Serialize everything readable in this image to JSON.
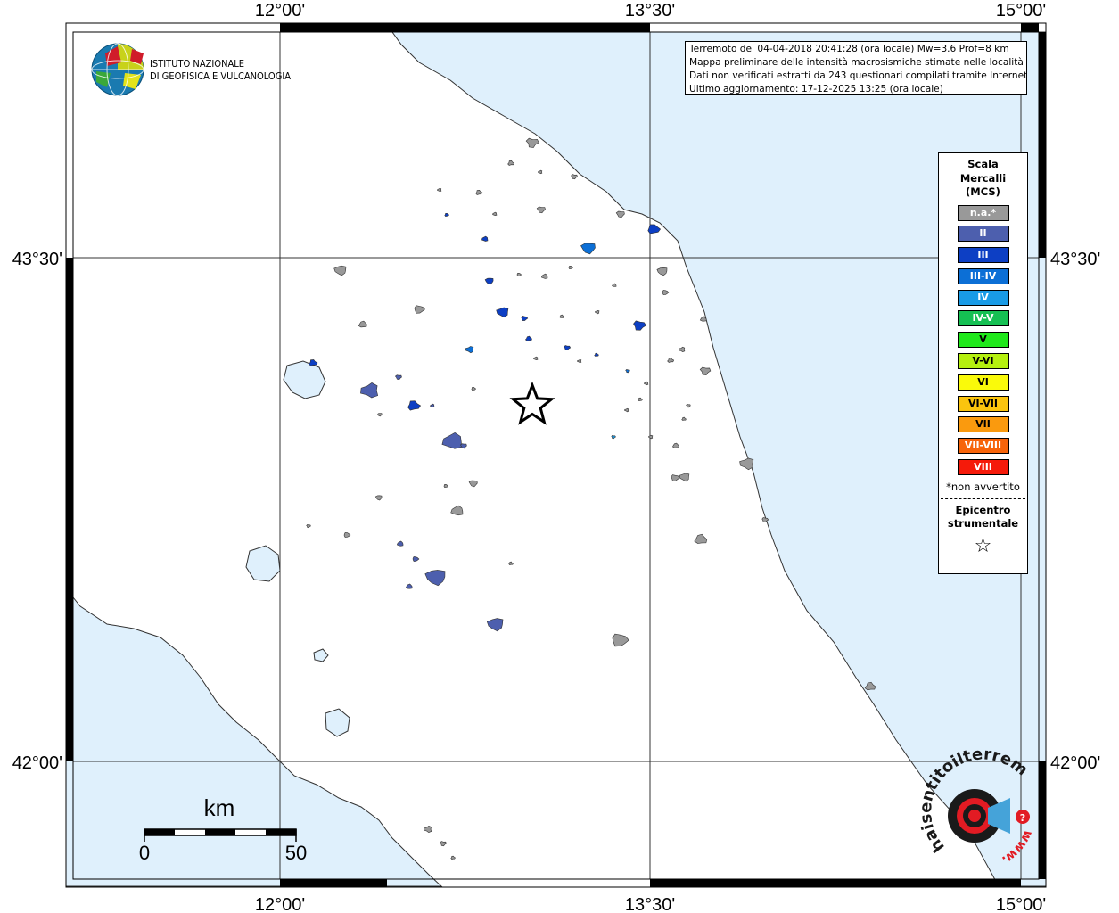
{
  "axes": {
    "top": [
      "12°00'",
      "13°30'",
      "15°00'"
    ],
    "bottom": [
      "12°00'",
      "13°30'",
      "15°00'"
    ],
    "left": [
      "43°30'",
      "42°00'"
    ],
    "right": [
      "43°30'",
      "42°00'"
    ]
  },
  "institute": {
    "line1": "ISTITUTO NAZIONALE",
    "line2": "DI GEOFISICA E VULCANOLOGIA"
  },
  "info": {
    "line1": "Terremoto del 04-04-2018 20:41:28 (ora locale) Mw=3.6 Prof=8 km",
    "line2": "Mappa preliminare delle intensità macrosismiche stimate nelle località",
    "line3": "Dati non verificati estratti da 243 questionari compilati tramite Internet.",
    "line4": "Ultimo aggiornamento: 17-12-2025 13:25 (ora locale)"
  },
  "legend": {
    "title1": "Scala",
    "title2": "Mercalli",
    "title3": "(MCS)",
    "items": [
      {
        "label": "n.a.*",
        "color": "#999999"
      },
      {
        "label": "II",
        "color": "#4d5fae"
      },
      {
        "label": "III",
        "color": "#0d3fc4"
      },
      {
        "label": "III-IV",
        "color": "#0c6fd6"
      },
      {
        "label": "IV",
        "color": "#199be6"
      },
      {
        "label": "IV-V",
        "color": "#15c053"
      },
      {
        "label": "V",
        "color": "#1fe81b"
      },
      {
        "label": "V-VI",
        "color": "#b5f00f"
      },
      {
        "label": "VI",
        "color": "#fafa0a"
      },
      {
        "label": "VI-VII",
        "color": "#fac40e"
      },
      {
        "label": "VII",
        "color": "#fa9a0e"
      },
      {
        "label": "VII-VIII",
        "color": "#f7640a"
      },
      {
        "label": "VIII",
        "color": "#f51a0a"
      }
    ],
    "note": "*non avvertito",
    "epicenter1": "Epicentro",
    "epicenter2": "strumentale"
  },
  "scale_bar": {
    "unit": "km",
    "min": "0",
    "max": "50"
  },
  "watermark": {
    "text": "haisentitoilterremoto.it",
    "www": "www."
  },
  "colors": {
    "sea": "#dff0fc",
    "land": "#ffffff",
    "na": "#999999",
    "ii": "#4d5fae",
    "iii": "#0d3fc4",
    "iii_iv": "#0c6fd6",
    "iv": "#199be6"
  }
}
